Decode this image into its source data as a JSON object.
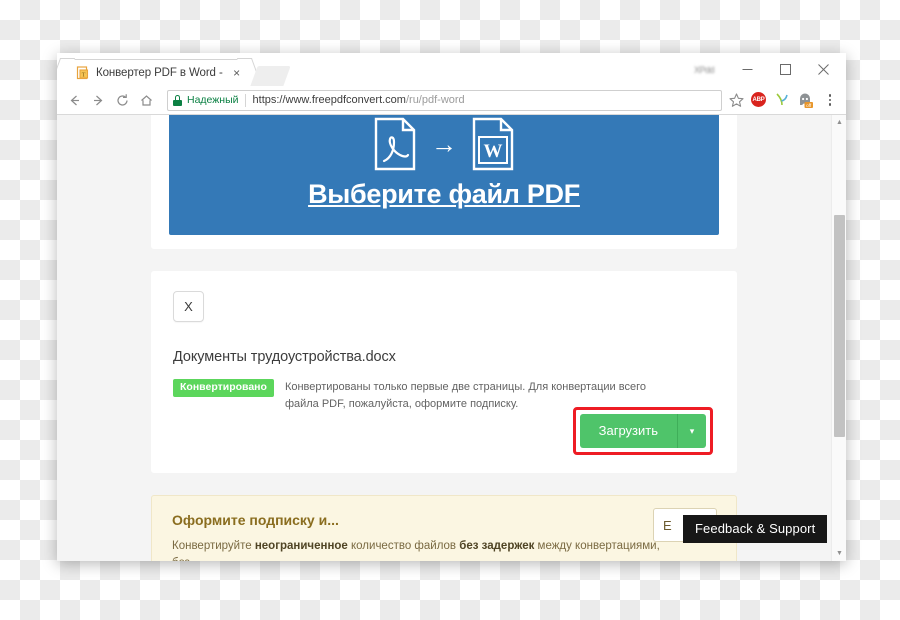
{
  "window": {
    "blurred_label": "XPdd",
    "minimize_icon": "minimize-icon",
    "maximize_icon": "maximize-icon",
    "close_icon": "close-icon"
  },
  "tab": {
    "title": "Конвертер PDF в Word -",
    "favicon": "pdf-document-icon",
    "close_label": "×",
    "newtab_label": ""
  },
  "toolbar": {
    "back_label": "←",
    "forward_label": "→",
    "reload_label": "C",
    "home_label": "⌂",
    "secure_label": "Надежный",
    "url_host": "https://www.freepdfconvert.com",
    "url_path": "/ru/pdf-word",
    "bookmark_icon": "star-icon",
    "ext_adblock_label": "ABP",
    "ext_adblock_name": "adblock-plus-icon",
    "ext_translate_name": "translate-icon",
    "ext_ghostery_name": "ghostery-icon",
    "ext_ghostery_badge": "off",
    "menu_icon": "three-dots-menu-icon"
  },
  "page": {
    "blue_banner": {
      "source_format": "PDF",
      "target_format": "W",
      "arrow": "→",
      "select_file_link": "Выберите файл PDF"
    },
    "file_card": {
      "remove_label": "X",
      "file_name": "Документы трудоустройства.docx",
      "status_badge": "Конвертировано",
      "status_text": "Конвертированы только первые две страницы. Для конвертации всего файла PDF, пожалуйста, оформите подписку.",
      "download_label": "Загрузить",
      "download_caret": "▾",
      "highlight_color": "#ee1c24"
    },
    "promo_card": {
      "title": "Оформите подписку и...",
      "text_part1": "Конвертируйте ",
      "text_bold1": "неограниченное",
      "text_part2": " количество файлов ",
      "text_bold2": "без задержек",
      "text_part3": " между конвертациями, без",
      "button_label": "E"
    },
    "feedback_tooltip": "Feedback & Support"
  },
  "colors": {
    "banner_blue": "#3479b7",
    "badge_green": "#5cd65c",
    "download_green": "#4fc46a",
    "promo_yellow": "#fbf6e2",
    "secure_green": "#0b8043"
  }
}
